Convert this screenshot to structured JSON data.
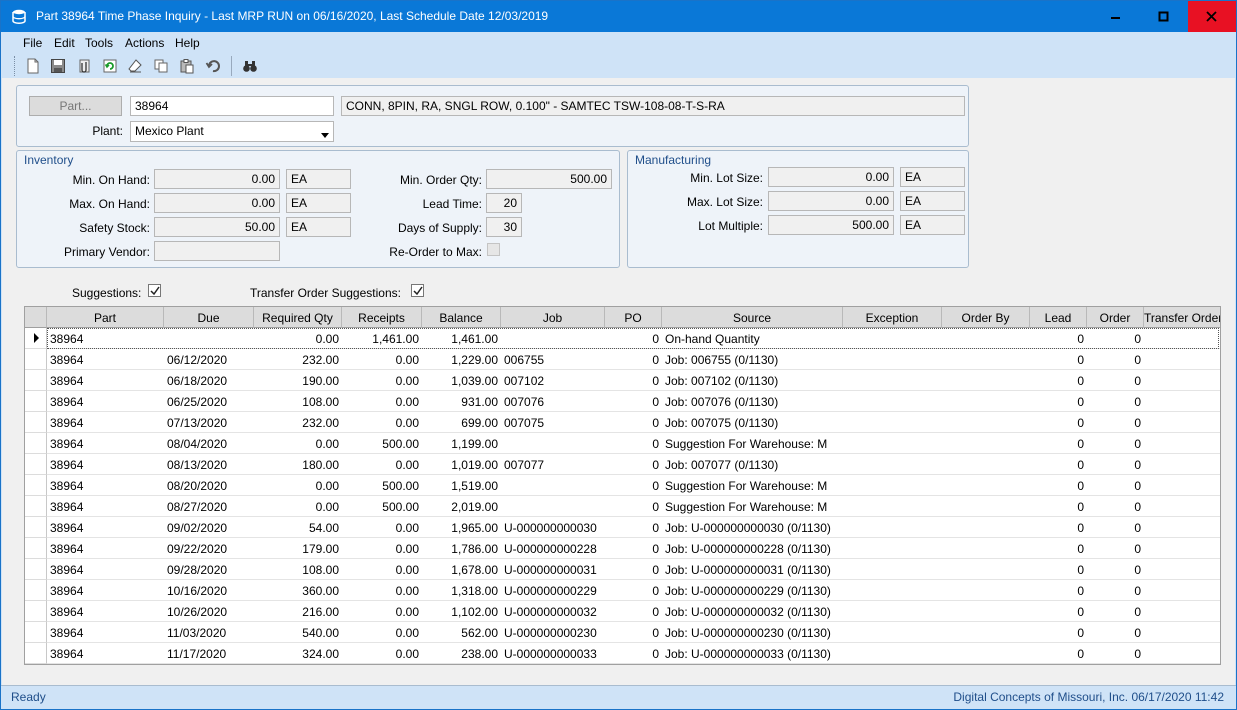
{
  "window": {
    "title": "Part 38964 Time Phase Inquiry  - Last MRP RUN on 06/16/2020, Last Schedule Date  12/03/2019",
    "icon": "database-icon"
  },
  "menu": [
    "File",
    "Edit",
    "Tools",
    "Actions",
    "Help"
  ],
  "toolbar": [
    "new-icon",
    "save-icon",
    "attachment-icon",
    "refresh-icon",
    "clear-icon",
    "copy-icon",
    "paste-icon",
    "undo-icon",
    "binoculars-icon"
  ],
  "part": {
    "button_label": "Part...",
    "number": "38964",
    "description": "CONN, 8PIN, RA, SNGL ROW, 0.100\" - SAMTEC TSW-108-08-T-S-RA",
    "plant_label": "Plant:",
    "plant_value": "Mexico Plant"
  },
  "inventory": {
    "title": "Inventory",
    "min_on_hand_label": "Min. On Hand:",
    "min_on_hand": "0.00",
    "min_on_hand_uom": "EA",
    "max_on_hand_label": "Max. On Hand:",
    "max_on_hand": "0.00",
    "max_on_hand_uom": "EA",
    "safety_stock_label": "Safety Stock:",
    "safety_stock": "50.00",
    "safety_stock_uom": "EA",
    "primary_vendor_label": "Primary Vendor:",
    "primary_vendor": "",
    "min_order_qty_label": "Min. Order Qty:",
    "min_order_qty": "500.00",
    "lead_time_label": "Lead Time:",
    "lead_time": "20",
    "days_of_supply_label": "Days of Supply:",
    "days_of_supply": "30",
    "reorder_to_max_label": "Re-Order to Max:"
  },
  "manufacturing": {
    "title": "Manufacturing",
    "min_lot_label": "Min. Lot Size:",
    "min_lot": "0.00",
    "min_lot_uom": "EA",
    "max_lot_label": "Max. Lot Size:",
    "max_lot": "0.00",
    "max_lot_uom": "EA",
    "lot_multiple_label": "Lot Multiple:",
    "lot_multiple": "500.00",
    "lot_multiple_uom": "EA"
  },
  "options": {
    "suggestions_label": "Suggestions:",
    "transfer_label": "Transfer Order Suggestions:"
  },
  "grid": {
    "columns": [
      "Part",
      "Due",
      "Required Qty",
      "Receipts",
      "Balance",
      "Job",
      "PO",
      "Source",
      "Exception",
      "Order By",
      "Lead",
      "Order",
      "Transfer Order"
    ],
    "rows": [
      [
        "38964",
        "",
        "0.00",
        "1,461.00",
        "1,461.00",
        "",
        "0",
        "On-hand Quantity",
        "",
        "",
        "0",
        "0",
        ""
      ],
      [
        "38964",
        "06/12/2020",
        "232.00",
        "0.00",
        "1,229.00",
        "006755",
        "0",
        "Job: 006755 (0/1130)",
        "",
        "",
        "0",
        "0",
        ""
      ],
      [
        "38964",
        "06/18/2020",
        "190.00",
        "0.00",
        "1,039.00",
        "007102",
        "0",
        "Job: 007102 (0/1130)",
        "",
        "",
        "0",
        "0",
        ""
      ],
      [
        "38964",
        "06/25/2020",
        "108.00",
        "0.00",
        "931.00",
        "007076",
        "0",
        "Job: 007076 (0/1130)",
        "",
        "",
        "0",
        "0",
        ""
      ],
      [
        "38964",
        "07/13/2020",
        "232.00",
        "0.00",
        "699.00",
        "007075",
        "0",
        "Job: 007075 (0/1130)",
        "",
        "",
        "0",
        "0",
        ""
      ],
      [
        "38964",
        "08/04/2020",
        "0.00",
        "500.00",
        "1,199.00",
        "",
        "0",
        "Suggestion For Warehouse: M",
        "",
        "",
        "0",
        "0",
        ""
      ],
      [
        "38964",
        "08/13/2020",
        "180.00",
        "0.00",
        "1,019.00",
        "007077",
        "0",
        "Job: 007077 (0/1130)",
        "",
        "",
        "0",
        "0",
        ""
      ],
      [
        "38964",
        "08/20/2020",
        "0.00",
        "500.00",
        "1,519.00",
        "",
        "0",
        "Suggestion For Warehouse: M",
        "",
        "",
        "0",
        "0",
        ""
      ],
      [
        "38964",
        "08/27/2020",
        "0.00",
        "500.00",
        "2,019.00",
        "",
        "0",
        "Suggestion For Warehouse: M",
        "",
        "",
        "0",
        "0",
        ""
      ],
      [
        "38964",
        "09/02/2020",
        "54.00",
        "0.00",
        "1,965.00",
        "U-000000000030",
        "0",
        "Job: U-000000000030 (0/1130)",
        "",
        "",
        "0",
        "0",
        ""
      ],
      [
        "38964",
        "09/22/2020",
        "179.00",
        "0.00",
        "1,786.00",
        "U-000000000228",
        "0",
        "Job: U-000000000228 (0/1130)",
        "",
        "",
        "0",
        "0",
        ""
      ],
      [
        "38964",
        "09/28/2020",
        "108.00",
        "0.00",
        "1,678.00",
        "U-000000000031",
        "0",
        "Job: U-000000000031 (0/1130)",
        "",
        "",
        "0",
        "0",
        ""
      ],
      [
        "38964",
        "10/16/2020",
        "360.00",
        "0.00",
        "1,318.00",
        "U-000000000229",
        "0",
        "Job: U-000000000229 (0/1130)",
        "",
        "",
        "0",
        "0",
        ""
      ],
      [
        "38964",
        "10/26/2020",
        "216.00",
        "0.00",
        "1,102.00",
        "U-000000000032",
        "0",
        "Job: U-000000000032 (0/1130)",
        "",
        "",
        "0",
        "0",
        ""
      ],
      [
        "38964",
        "11/03/2020",
        "540.00",
        "0.00",
        "562.00",
        "U-000000000230",
        "0",
        "Job: U-000000000230 (0/1130)",
        "",
        "",
        "0",
        "0",
        ""
      ],
      [
        "38964",
        "11/17/2020",
        "324.00",
        "0.00",
        "238.00",
        "U-000000000033",
        "0",
        "Job: U-000000000033 (0/1130)",
        "",
        "",
        "0",
        "0",
        ""
      ]
    ]
  },
  "status": {
    "left": "Ready",
    "right": "Digital Concepts of Missouri, Inc.   06/17/2020  11:42"
  }
}
